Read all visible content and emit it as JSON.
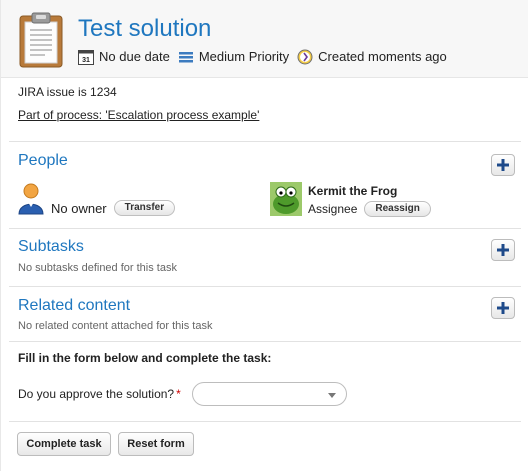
{
  "header": {
    "title": "Test solution",
    "due_date": "No due date",
    "priority": "Medium Priority",
    "created": "Created moments ago",
    "calendar_icon_text": "31"
  },
  "info": {
    "description": "JIRA issue is 1234",
    "process_link": "Part of process: 'Escalation process example'"
  },
  "people": {
    "title": "People",
    "owner": {
      "label": "No owner",
      "action": "Transfer"
    },
    "assignee": {
      "name": "Kermit the Frog",
      "label": "Assignee",
      "action": "Reassign"
    }
  },
  "subtasks": {
    "title": "Subtasks",
    "empty": "No subtasks defined for this task"
  },
  "related": {
    "title": "Related content",
    "empty": "No related content attached for this task"
  },
  "form": {
    "heading": "Fill in the form below and complete the task:",
    "field_label": "Do you approve the solution?",
    "required_mark": "*",
    "select_value": ""
  },
  "actions": {
    "complete": "Complete task",
    "reset": "Reset form"
  },
  "colors": {
    "accent": "#1f77bf",
    "required": "#cc0000",
    "plus_icon": "#1e4a8a"
  }
}
